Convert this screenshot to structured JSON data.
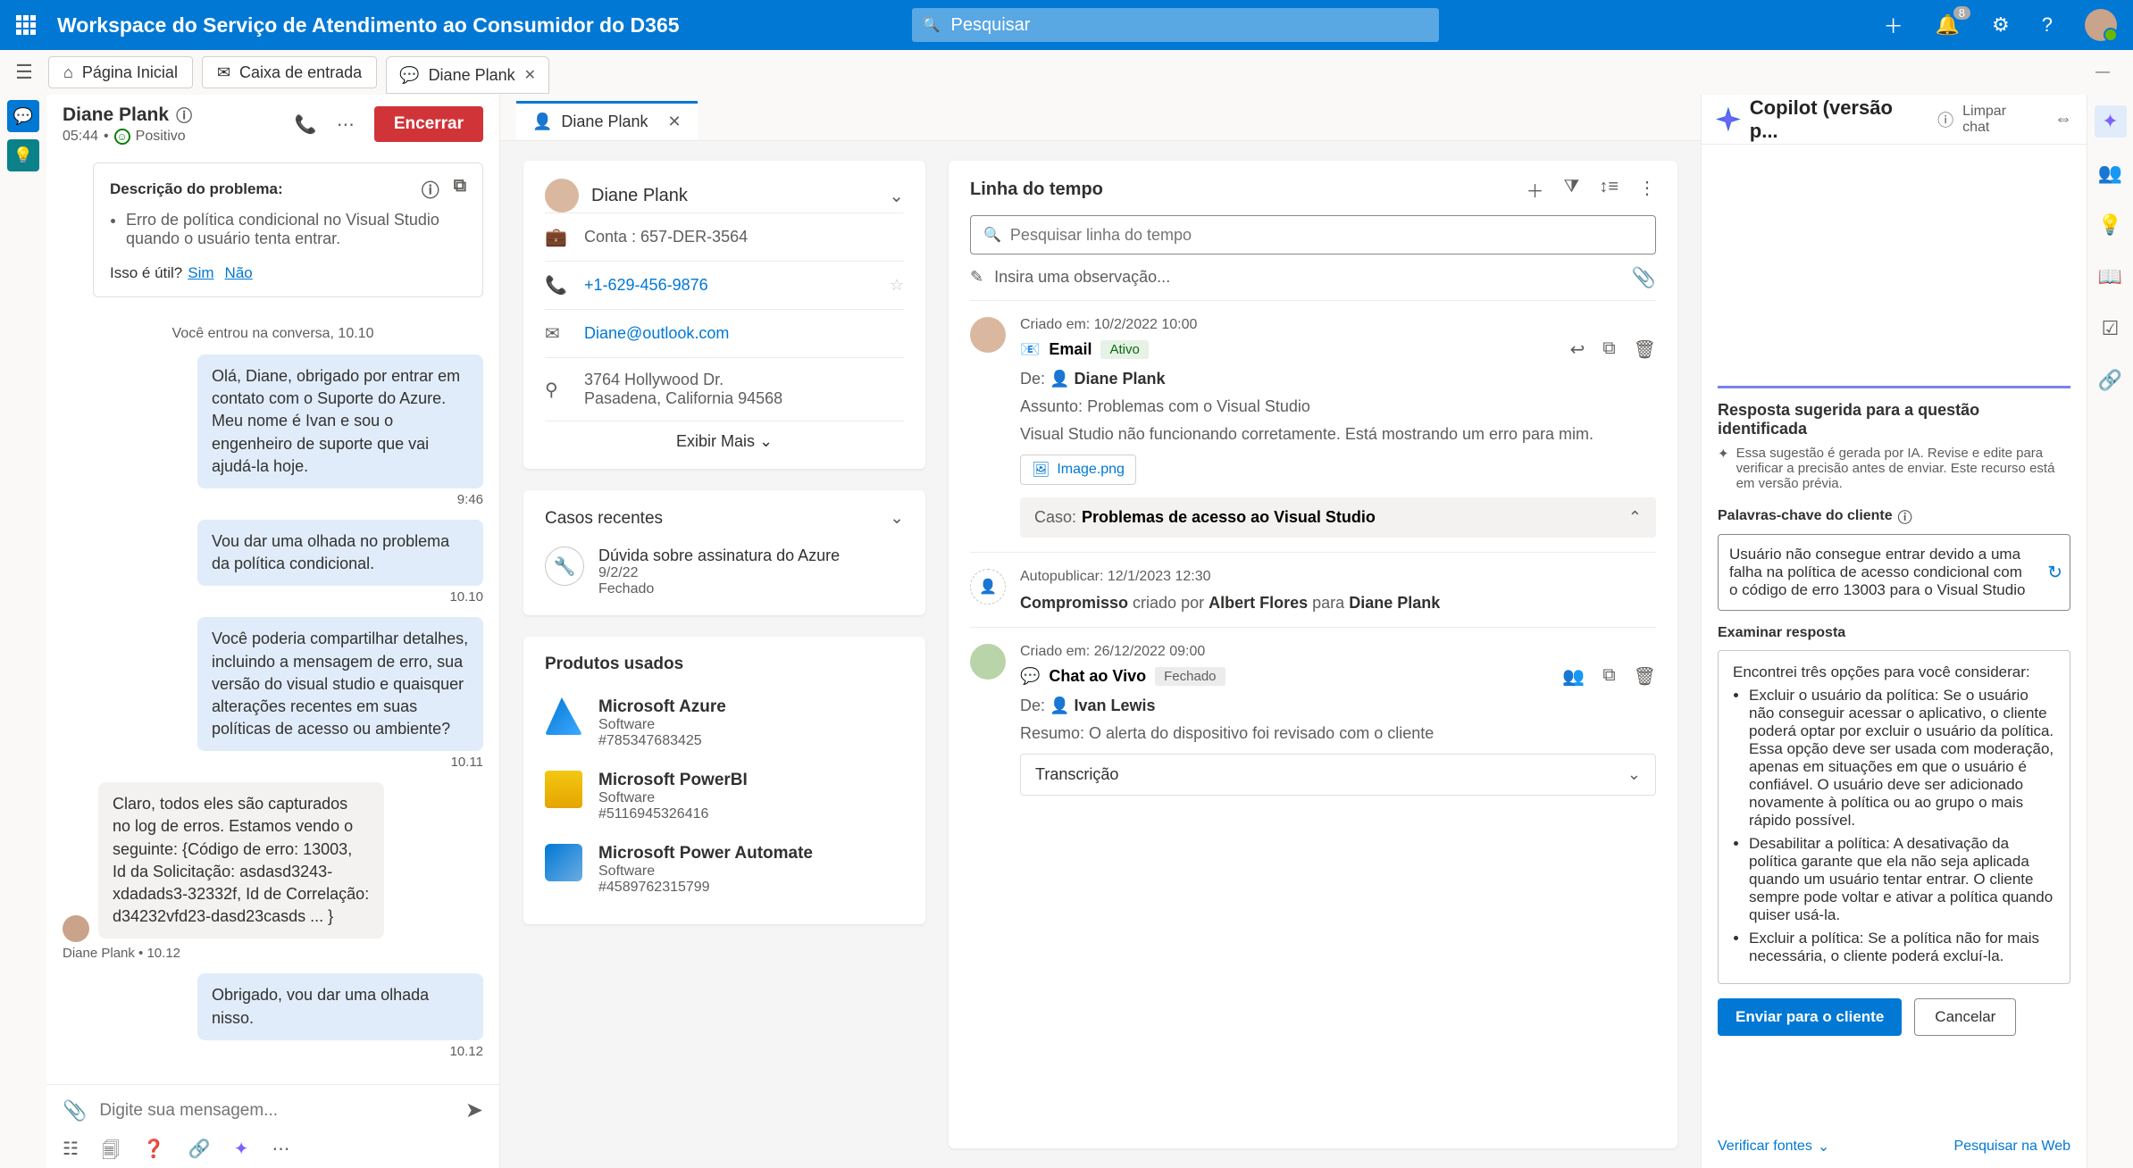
{
  "header": {
    "title": "Workspace do Serviço de Atendimento ao Consumidor do D365",
    "search_placeholder": "Pesquisar",
    "notification_count": "8"
  },
  "toolbar": {
    "home": "Página Inicial",
    "inbox": "Caixa de entrada",
    "session_tab": "Diane Plank"
  },
  "chat": {
    "customer_name": "Diane Plank",
    "elapsed": "05:44",
    "sentiment": "Positivo",
    "end_button": "Encerrar",
    "problem_title": "Descrição do problema:",
    "problem_text": "Erro de política condicional no Visual Studio quando o usuário tenta entrar.",
    "useful_q": "Isso é útil?",
    "yes": "Sim",
    "no": "Não",
    "system_joined": "Você entrou na conversa, 10.10",
    "messages": [
      {
        "dir": "out",
        "text": "Olá, Diane, obrigado por entrar em contato com o Suporte do Azure. Meu nome é Ivan e sou o engenheiro de suporte que vai ajudá-la hoje.",
        "time": "9:46"
      },
      {
        "dir": "out",
        "text": "Vou dar uma olhada no problema da política condicional.",
        "time": "10.10"
      },
      {
        "dir": "out",
        "text": "Você poderia compartilhar detalhes, incluindo a mensagem de erro, sua versão do visual studio e quaisquer alterações recentes em suas políticas de acesso ou ambiente?",
        "time": "10.11"
      },
      {
        "dir": "in",
        "text": "Claro, todos eles são capturados no log de erros. Estamos vendo o seguinte: {Código de erro: 13003, Id da Solicitação: asdasd3243-xdadads3-32332f, Id de Correlação: d34232vfd23-dasd23casds ... }",
        "meta": "Diane Plank  •  10.12"
      },
      {
        "dir": "out",
        "text": "Obrigado, vou dar uma olhada nisso.",
        "time": "10.12"
      }
    ],
    "composer_placeholder": "Digite sua mensagem..."
  },
  "record_tab": "Diane Plank",
  "contact": {
    "name": "Diane Plank",
    "account_label": "Conta : 657-DER-3564",
    "phone": "+1-629-456-9876",
    "email": "Diane@outlook.com",
    "addr1": "3764 Hollywood Dr.",
    "addr2": "Pasadena, California 94568",
    "show_more": "Exibir Mais"
  },
  "recent_cases": {
    "title": "Casos recentes",
    "item": {
      "title": "Dúvida sobre assinatura do Azure",
      "date": "9/2/22",
      "status": "Fechado"
    }
  },
  "products": {
    "title": "Produtos usados",
    "items": [
      {
        "name": "Microsoft Azure",
        "type": "Software",
        "id": "#785347683425"
      },
      {
        "name": "Microsoft PowerBI",
        "type": "Software",
        "id": "#5116945326416"
      },
      {
        "name": "Microsoft Power Automate",
        "type": "Software",
        "id": "#4589762315799"
      }
    ]
  },
  "timeline": {
    "title": "Linha do tempo",
    "search_placeholder": "Pesquisar linha do tempo",
    "note_placeholder": "Insira uma observação...",
    "item1": {
      "created_label": "Criado em:",
      "created": "10/2/2022 10:00",
      "type": "Email",
      "status": "Ativo",
      "from_label": "De:",
      "from": "Diane Plank",
      "subject_label": "Assunto:",
      "subject": "Problemas com o Visual Studio",
      "body": "Visual Studio não funcionando corretamente. Está mostrando um erro para mim.",
      "attachment": "Image.png",
      "case_label": "Caso:",
      "case": "Problemas de acesso ao Visual Studio"
    },
    "item2": {
      "auto_label": "Autopublicar:",
      "auto": "12/1/2023 12:30",
      "type": "Compromisso",
      "created_by_label": "criado por",
      "created_by": "Albert Flores",
      "for_label": "para",
      "for": "Diane Plank"
    },
    "item3": {
      "created_label": "Criado em:",
      "created": "26/12/2022 09:00",
      "type": "Chat ao Vivo",
      "status": "Fechado",
      "from_label": "De:",
      "from": "Ivan Lewis",
      "summary_label": "Resumo:",
      "summary": "O alerta do dispositivo foi revisado com o cliente",
      "transcript": "Transcrição"
    }
  },
  "copilot": {
    "title": "Copilot (versão p...",
    "clear": "Limpar chat",
    "section_title": "Resposta sugerida para a questão identificada",
    "ai_disclaimer": "Essa sugestão é gerada por IA. Revise e edite para verificar a precisão antes de enviar. Este recurso está em versão prévia.",
    "keywords_label": "Palavras-chave do cliente",
    "keywords": "Usuário não consegue entrar devido a uma falha na política de acesso condicional com o código de erro 13003 para o Visual Studio",
    "examine_label": "Examinar resposta",
    "response_intro": "Encontrei três opções para você considerar:",
    "response_items": [
      "Excluir o usuário da política: Se o usuário não conseguir acessar o aplicativo, o cliente poderá optar por excluir o usuário da política. Essa opção deve ser usada com moderação, apenas em situações em que o usuário é confiável. O usuário deve ser adicionado novamente à política ou ao grupo o mais rápido possível.",
      "Desabilitar a política: A desativação da política garante que ela não seja aplicada quando um usuário tentar entrar. O cliente sempre pode voltar e ativar a política quando quiser usá-la.",
      "Excluir a política: Se a política não for mais necessária, o cliente poderá excluí-la."
    ],
    "send_btn": "Enviar para o cliente",
    "cancel_btn": "Cancelar",
    "verify": "Verificar fontes",
    "web": "Pesquisar na Web"
  }
}
